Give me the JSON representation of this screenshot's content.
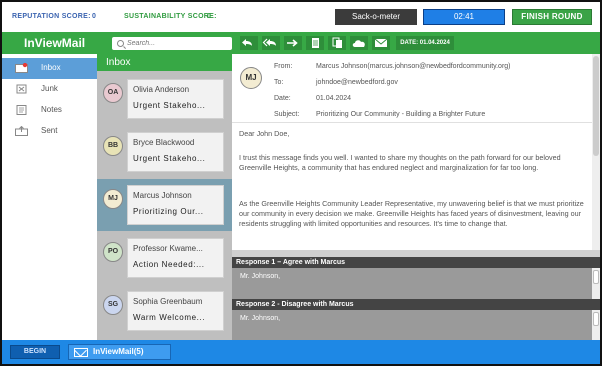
{
  "status": {
    "reputation_label": "REPUTATION SCORE:",
    "reputation_value": "0",
    "sustainability_label": "SUSTAINABILITY SCORE:",
    "sustainability_value": "0",
    "sack_label": "Sack-o-meter",
    "timer": "02:41",
    "finish_label": "FINISH ROUND"
  },
  "app": {
    "title": "InViewMail",
    "search_placeholder": "Search...",
    "date_label": "DATE: 01.04.2024",
    "toolbar_icons": [
      "reply-icon",
      "reply-all-icon",
      "forward-icon",
      "document-icon",
      "copy-icon",
      "cloud-icon",
      "mail-icon"
    ]
  },
  "nav": {
    "items": [
      {
        "label": "Inbox",
        "icon": "inbox-icon",
        "active": true
      },
      {
        "label": "Junk",
        "icon": "junk-icon",
        "active": false
      },
      {
        "label": "Notes",
        "icon": "notes-icon",
        "active": false
      },
      {
        "label": "Sent",
        "icon": "sent-icon",
        "active": false
      }
    ]
  },
  "inbox": {
    "title": "Inbox",
    "messages": [
      {
        "initials": "OA",
        "sender": "Olivia Anderson",
        "subject": "Urgent Stakeho...",
        "avatar_color": "#e9c9d0"
      },
      {
        "initials": "BB",
        "sender": "Bryce Blackwood",
        "subject": "Urgent Stakeho...",
        "avatar_color": "#e8e3b6"
      },
      {
        "initials": "MJ",
        "sender": "Marcus Johnson",
        "subject": "Prioritizing Our...",
        "avatar_color": "#f3ecd2",
        "selected": true
      },
      {
        "initials": "PO",
        "sender": "Professor Kwame...",
        "subject": "Action Needed:...",
        "avatar_color": "#cfe3c8"
      },
      {
        "initials": "SG",
        "sender": "Sophia Greenbaum",
        "subject": "Warm Welcome...",
        "avatar_color": "#cbd6ef"
      }
    ]
  },
  "email": {
    "initials": "MJ",
    "from_label": "From:",
    "from": "Marcus Johnson(marcus.johnson@newbedfordcommunity.org)",
    "to_label": "To:",
    "to": "johndoe@newbedford.gov",
    "date_label": "Date:",
    "date": "01.04.2024",
    "subject_label": "Subject:",
    "subject": "Prioritizing Our Community - Building a Brighter Future",
    "greeting": "Dear John Doe,",
    "p1": "I trust this message finds you well. I wanted to share my thoughts on the path forward for our beloved Greenville Heights, a community that has endured neglect and marginalization for far too long.",
    "p2": "As the Greenville Heights Community Leader Representative, my unwavering belief is that we must prioritize our community in every decision we make. Greenville Heights has faced years of disinvestment, leaving our residents struggling with limited opportunities and resources. It's time to change that."
  },
  "responses": [
    {
      "title": "Response 1 – Agree with Marcus",
      "text": "Mr. Johnson,"
    },
    {
      "title": "Response 2 - Disagree with Marcus",
      "text": "Mr. Johnson,"
    }
  ],
  "taskbar": {
    "begin_label": "BEGIN",
    "app_label": "InViewMail(5)"
  },
  "colors": {
    "brand_green": "#37a845",
    "selection_blue": "#5c9ed8",
    "taskbar_blue": "#1e88e5"
  }
}
